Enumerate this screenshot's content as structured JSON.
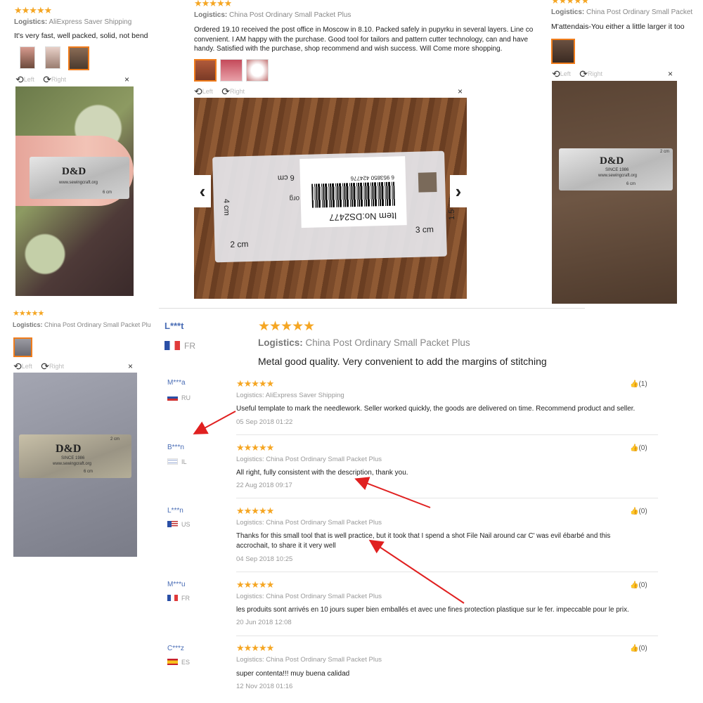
{
  "stars": "★★★★★",
  "icons": {
    "rotate_left": "rotate-left-icon",
    "rotate_right": "rotate-right-icon",
    "close": "close-icon",
    "prev": "chevron-left-icon",
    "next": "chevron-right-icon",
    "like": "thumbs-up-icon"
  },
  "colors": {
    "star": "#f5a623",
    "selected_thumb": "#f07c1b",
    "username": "#4a6db5",
    "arrow": "#e02020"
  },
  "viewer": {
    "left": "Left",
    "right": "Right",
    "close": "×",
    "prev": "‹",
    "next": "›"
  },
  "card1": {
    "logistics_label": "Logistics:",
    "logistics": "AliExpress Saver Shipping",
    "text": "It's very fast, well packed, solid, not bend"
  },
  "card2": {
    "logistics_label": "Logistics:",
    "logistics": "China Post Ordinary Small Packet Plus",
    "text": "Ordered 19.10 received the post office in Moscow in 8.10. Packed safely in pupyrku in several layers. Line co\nconvenient. I AM happy with the purchase. Good tool for tailors and pattern cutter technology, can and have\nhandy. Satisfied with the purchase, shop recommend and wish success. Will Come more shopping.",
    "package": {
      "item_no": "Item No:DS2477",
      "barcode": "6 953850 424776",
      "label_org": "org",
      "label_6cm": "6 cm",
      "label_4cm": "4 cm",
      "label_2cm": "2 cm",
      "label_3cm": "3 cm",
      "label_15cm": "1.5 cm"
    }
  },
  "card3": {
    "logistics_label": "Logistics:",
    "logistics": "China Post Ordinary Small Packet",
    "text": "M'attendais-You either a little larger it too"
  },
  "card4": {
    "logistics_label": "Logistics:",
    "logistics": "China Post Ordinary Small Packet Plu"
  },
  "ruler": {
    "brand": "D&D",
    "since": "SINCE 1986",
    "site": "www.sewingcraft.org",
    "six": "6 cm",
    "two": "2 cm",
    "four": "4 cm"
  },
  "main_review": {
    "username": "L***t",
    "country": "FR",
    "logistics_label": "Logistics:",
    "logistics": "China Post Ordinary Small Packet Plus",
    "text": "Metal good quality. Very convenient to add the margins of stitching"
  },
  "reviews": [
    {
      "name": "M***a",
      "country": "RU",
      "logistics": "Logistics: AliExpress Saver Shipping",
      "text": "Useful template to mark the needlework. Seller worked quickly, the goods are delivered on time. Recommend product and seller.",
      "date": "05 Sep 2018 01:22",
      "likes": "(1)"
    },
    {
      "name": "B***n",
      "country": "IL",
      "logistics": "Logistics: China Post Ordinary Small Packet Plus",
      "text": "All right, fully consistent with the description, thank you.",
      "date": "22 Aug 2018 09:17",
      "likes": "(0)"
    },
    {
      "name": "L***n",
      "country": "US",
      "logistics": "Logistics: China Post Ordinary Small Packet Plus",
      "text": "Thanks for this small tool that is well practice, but it took that I spend a shot File Nail around car C' was evil ébarbé and this\naccrochait, to share it it very well",
      "date": "04 Sep 2018 10:25",
      "likes": "(0)"
    },
    {
      "name": "M***u",
      "country": "FR",
      "logistics": "Logistics: China Post Ordinary Small Packet Plus",
      "text": "les produits sont arrivés en 10 jours super bien emballés et avec une fines protection plastique sur le fer. impeccable pour le prix.",
      "date": "20 Jun 2018 12:08",
      "likes": "(0)"
    },
    {
      "name": "C***z",
      "country": "ES",
      "logistics": "Logistics: China Post Ordinary Small Packet Plus",
      "text": "super contenta!!! muy buena calidad",
      "date": "12 Nov 2018 01:16",
      "likes": "(0)"
    }
  ]
}
